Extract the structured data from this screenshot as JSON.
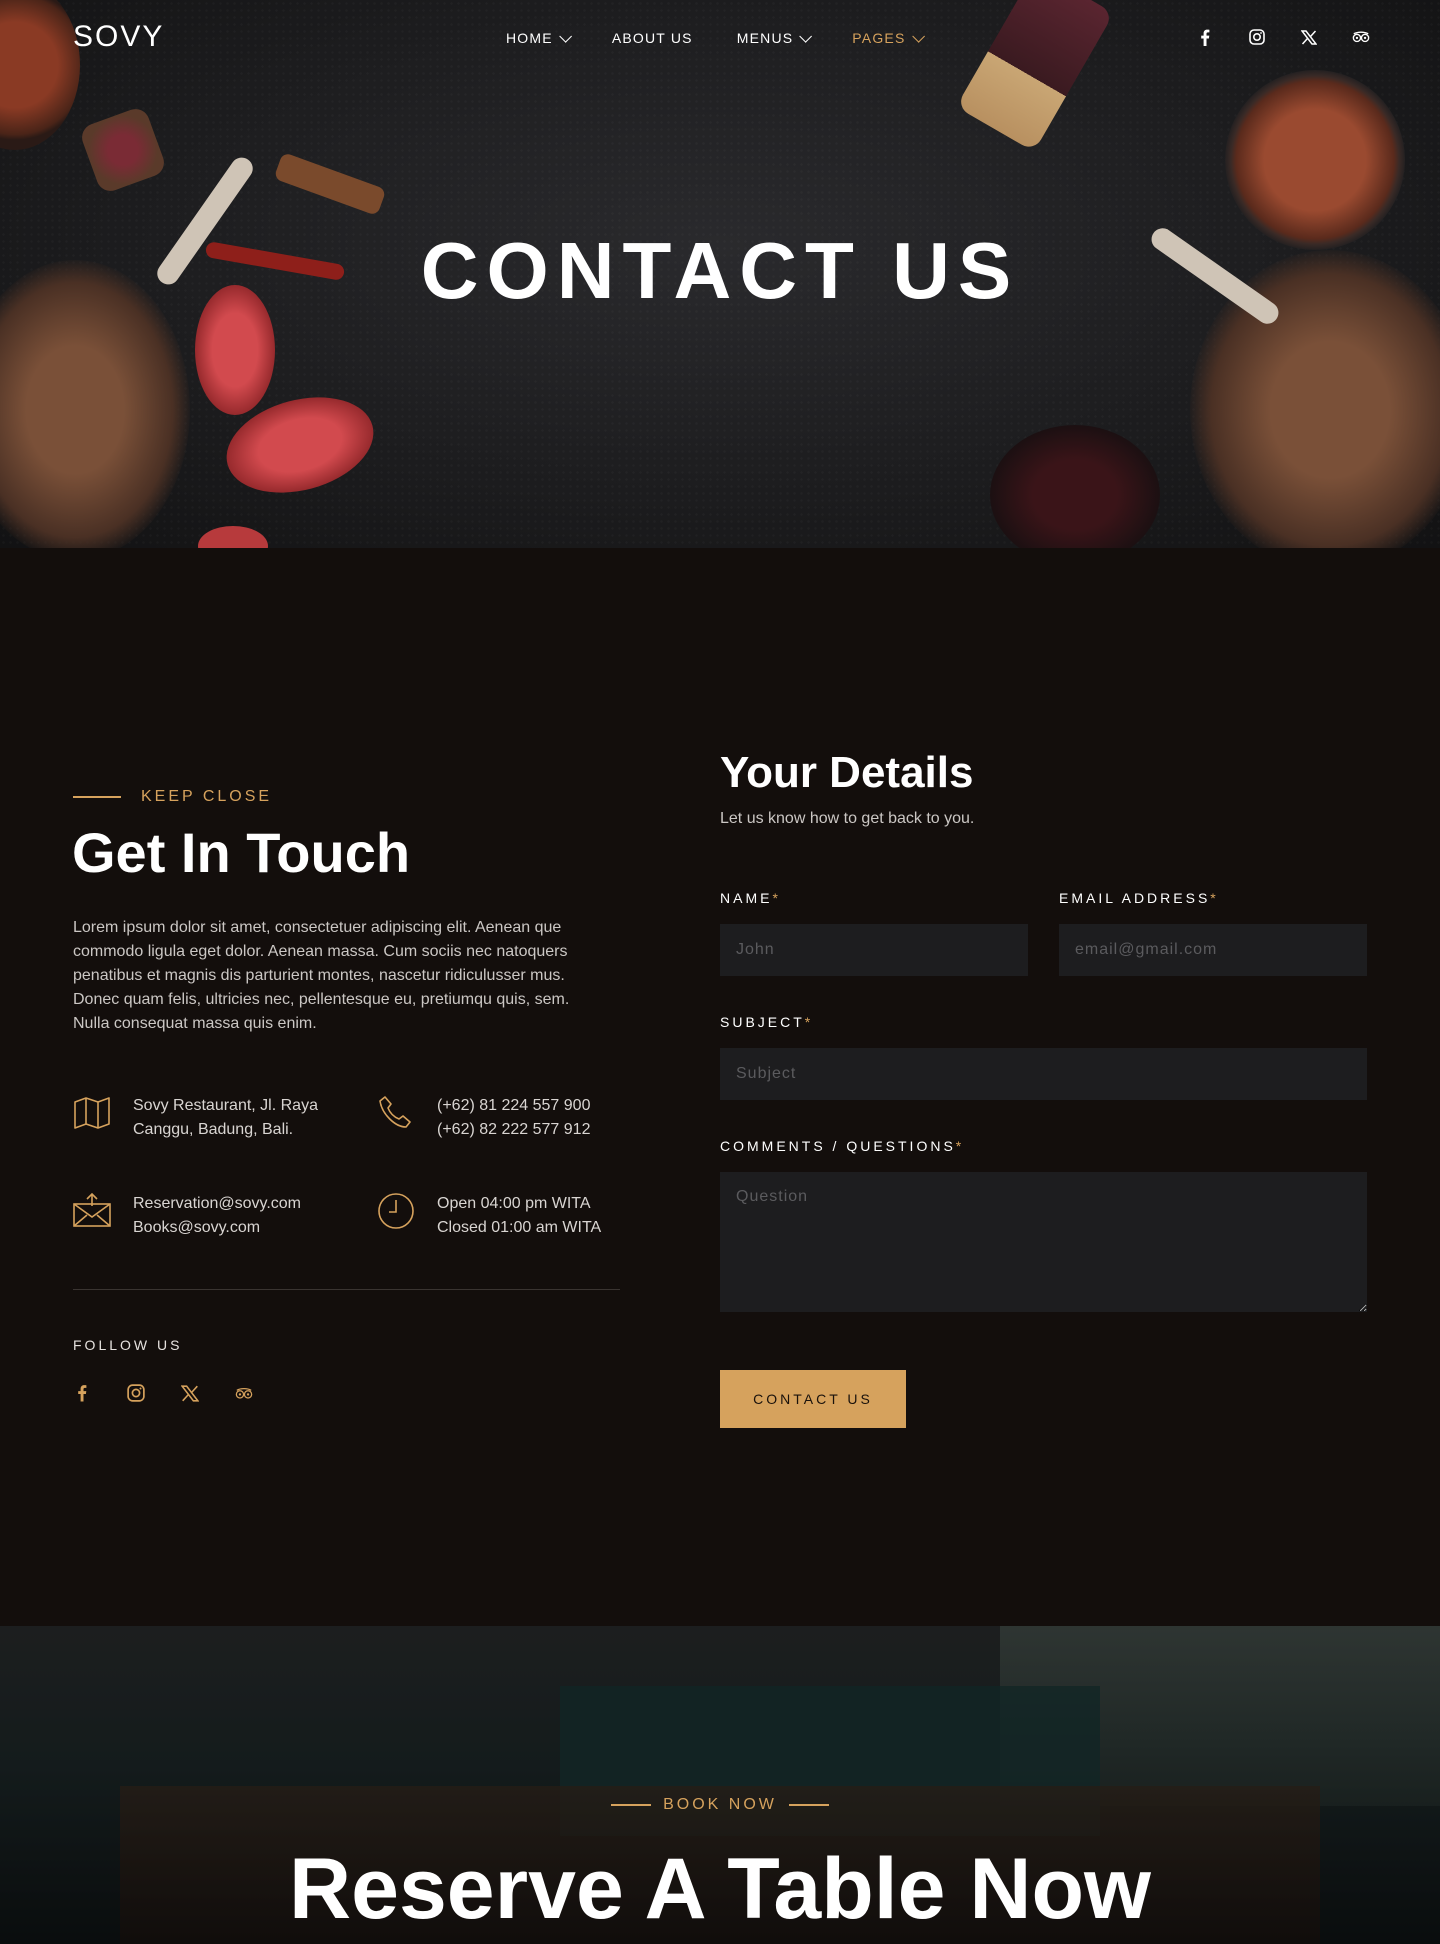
{
  "brand": {
    "logo": "SOVY",
    "accent": "#d6a25d",
    "background": "#130e0c"
  },
  "nav": {
    "items": [
      {
        "label": "HOME",
        "dropdown": true,
        "active": false
      },
      {
        "label": "ABOUT US",
        "dropdown": false,
        "active": false
      },
      {
        "label": "MENUS",
        "dropdown": true,
        "active": false
      },
      {
        "label": "PAGES",
        "dropdown": true,
        "active": true
      }
    ],
    "social": [
      "facebook-icon",
      "instagram-icon",
      "x-icon",
      "tripadvisor-icon"
    ]
  },
  "hero": {
    "title": "CONTACT US"
  },
  "contact_info": {
    "eyebrow": "KEEP CLOSE",
    "title": "Get In Touch",
    "text": "Lorem ipsum dolor sit amet, consectetuer adipiscing elit. Aenean que commodo ligula eget dolor. Aenean massa. Cum sociis nec natoquers penatibus et magnis dis parturient montes, nascetur ridiculusser mus. Donec quam felis, ultricies nec, pellentesque eu, pretiumqu quis, sem. Nulla consequat massa quis enim.",
    "address": {
      "line1": "Sovy Restaurant, Jl. Raya",
      "line2": "Canggu, Badung, Bali."
    },
    "phone": {
      "line1": "(+62) 81 224 557 900",
      "line2": "(+62) 82 222 577 912"
    },
    "email": {
      "line1": "Reservation@sovy.com",
      "line2": "Books@sovy.com"
    },
    "hours": {
      "line1": "Open 04:00 pm WITA",
      "line2": "Closed 01:00 am WITA"
    },
    "follow_label": "FOLLOW US"
  },
  "form": {
    "title": "Your Details",
    "subtitle": "Let us know how to get back to you.",
    "name_label": "NAME",
    "name_placeholder": "John",
    "email_label": "EMAIL ADDRESS",
    "email_placeholder": "email@gmail.com",
    "subject_label": "SUBJECT",
    "subject_placeholder": "Subject",
    "comments_label": "COMMENTS / QUESTIONS",
    "comments_placeholder": "Question",
    "required_mark": "*",
    "submit_label": "CONTACT US"
  },
  "reserve": {
    "eyebrow": "BOOK NOW",
    "title": "Reserve A Table Now"
  }
}
